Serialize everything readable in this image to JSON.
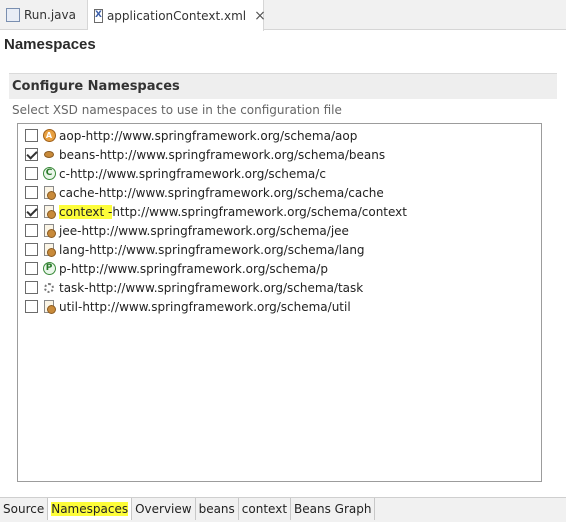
{
  "editor_tabs": [
    {
      "label": "Run.java",
      "icon": "java-file-icon"
    },
    {
      "label": "applicationContext.xml",
      "icon": "xml-file-icon",
      "close": "×"
    }
  ],
  "page_title": "Namespaces",
  "section": {
    "title": "Configure Namespaces",
    "description": "Select XSD namespaces to use in the configuration file"
  },
  "namespaces": [
    {
      "prefix": "aop",
      "uri": "http://www.springframework.org/schema/aop",
      "checked": false
    },
    {
      "prefix": "beans",
      "uri": "http://www.springframework.org/schema/beans",
      "checked": true
    },
    {
      "prefix": "c",
      "uri": "http://www.springframework.org/schema/c",
      "checked": false
    },
    {
      "prefix": "cache",
      "uri": "http://www.springframework.org/schema/cache",
      "checked": false
    },
    {
      "prefix": "context",
      "uri": "http://www.springframework.org/schema/context",
      "checked": true
    },
    {
      "prefix": "jee",
      "uri": "http://www.springframework.org/schema/jee",
      "checked": false
    },
    {
      "prefix": "lang",
      "uri": "http://www.springframework.org/schema/lang",
      "checked": false
    },
    {
      "prefix": "p",
      "uri": "http://www.springframework.org/schema/p",
      "checked": false
    },
    {
      "prefix": "task",
      "uri": "http://www.springframework.org/schema/task",
      "checked": false
    },
    {
      "prefix": "util",
      "uri": "http://www.springframework.org/schema/util",
      "checked": false
    }
  ],
  "separator": " - ",
  "bottom_tabs": [
    "Source",
    "Namespaces",
    "Overview",
    "beans",
    "context",
    "Beans Graph"
  ],
  "active_bottom_tab": "Namespaces",
  "highlight_color": "#fdfd3a"
}
